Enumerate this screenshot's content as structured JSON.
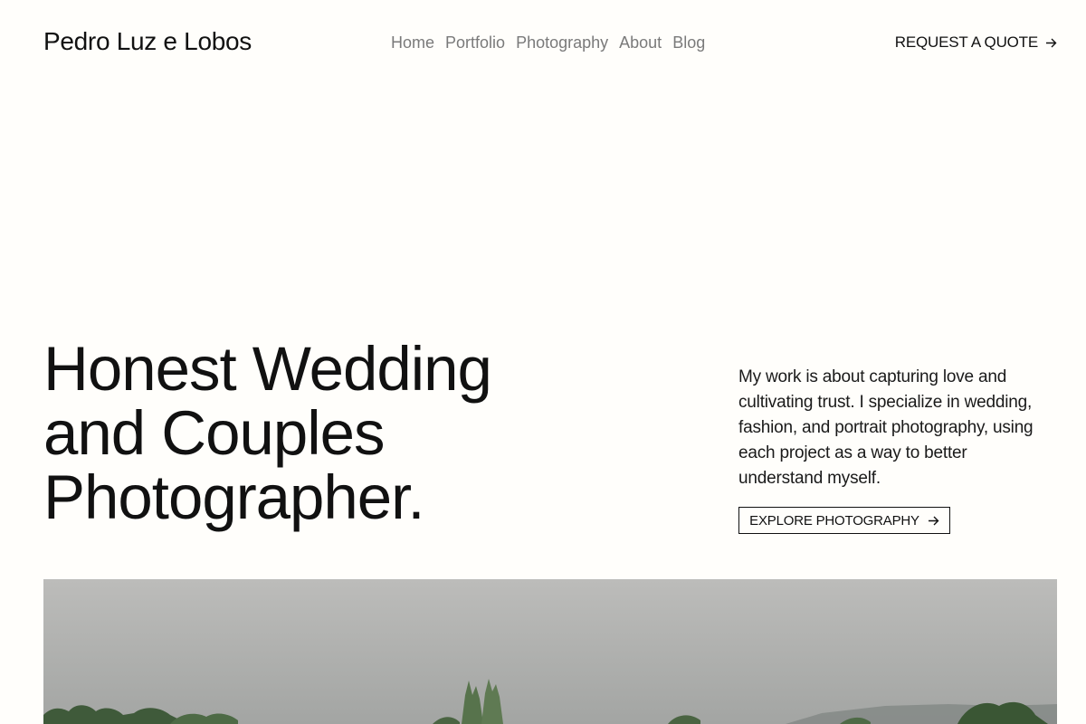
{
  "header": {
    "brand": "Pedro Luz e Lobos",
    "nav": [
      {
        "label": "Home"
      },
      {
        "label": "Portfolio"
      },
      {
        "label": "Photography"
      },
      {
        "label": "About"
      },
      {
        "label": "Blog"
      }
    ],
    "cta_label": "REQUEST A QUOTE",
    "cta_icon": "arrow-right-icon"
  },
  "hero": {
    "title_lines": [
      "Honest Wedding",
      "and Couples",
      "Photographer."
    ],
    "intro": "My work is about capturing love and cultivating trust. I specialize in wedding, fashion, and portrait photography, using each project as a way to better understand myself.",
    "explore_label": "EXPLORE PHOTOGRAPHY",
    "explore_icon": "arrow-right-icon"
  },
  "photo": {
    "subject": "overcast-sky-with-treeline"
  },
  "colors": {
    "background": "#fffefb",
    "text": "#111111",
    "nav_text": "#7a7a7a"
  }
}
